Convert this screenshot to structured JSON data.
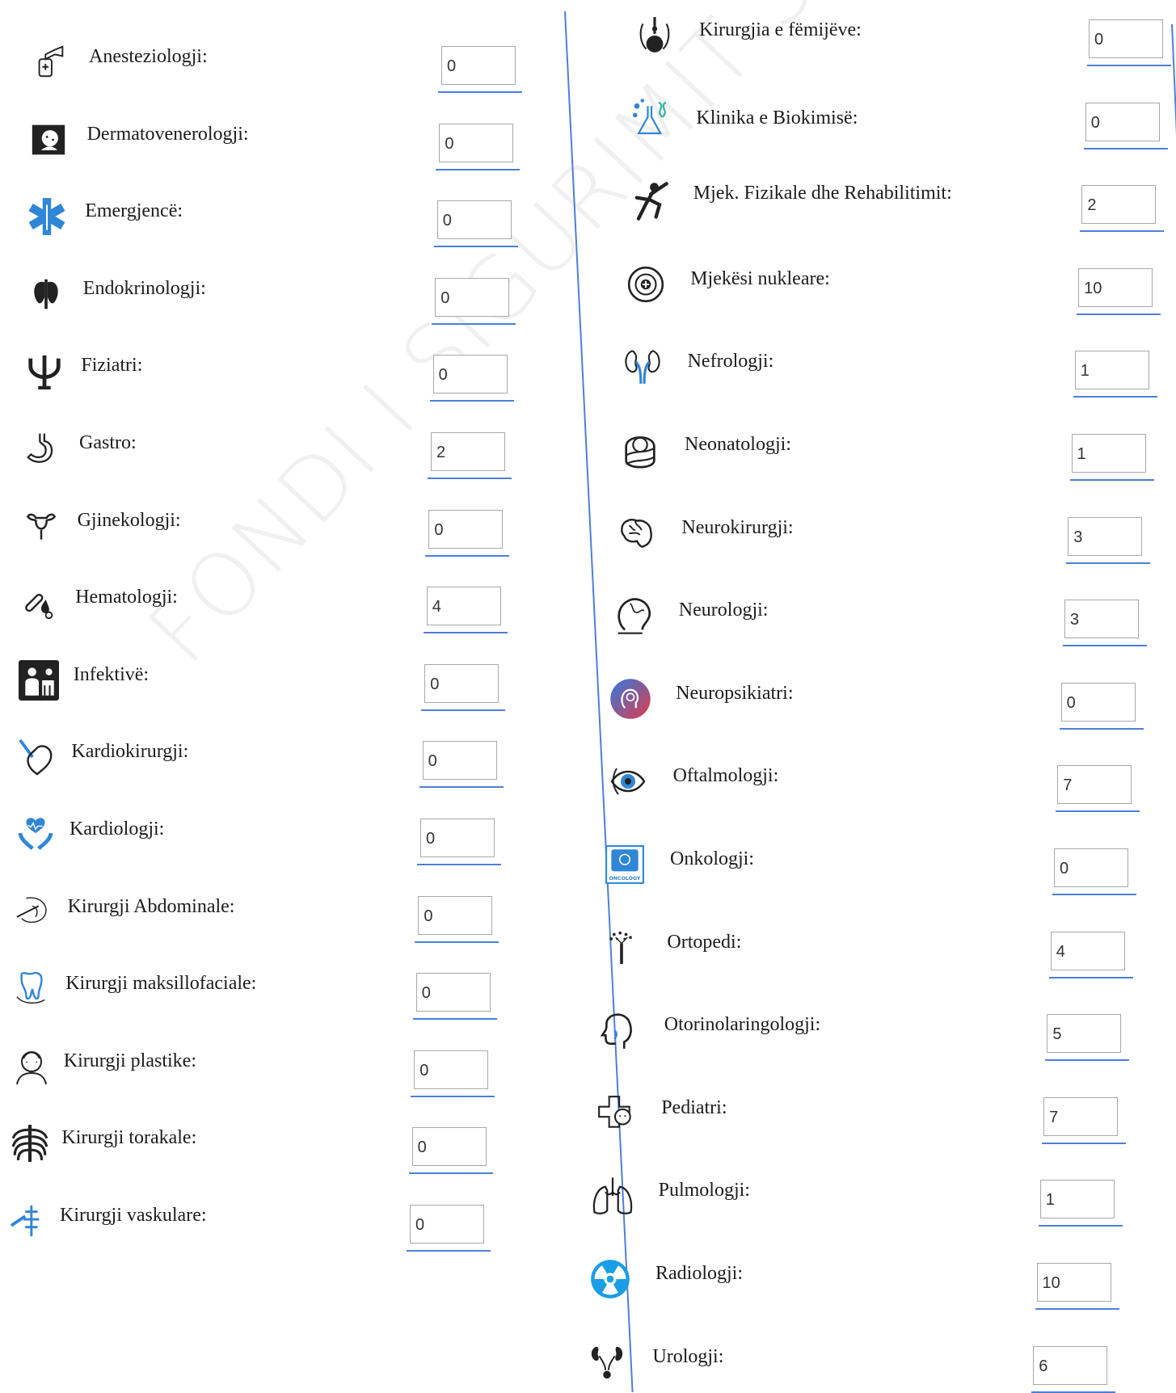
{
  "watermark": "FONDI I SIGURIMIT SHËNDETËSOR",
  "left_column": [
    {
      "label": "Anesteziologji:",
      "value": "0",
      "icon": "anesthesia-mask-icon"
    },
    {
      "label": "Dermatovenerologji:",
      "value": "0",
      "icon": "dermatology-face-icon"
    },
    {
      "label": "Emergjencë:",
      "value": "0",
      "icon": "star-of-life-icon"
    },
    {
      "label": "Endokrinologji:",
      "value": "0",
      "icon": "thyroid-gland-icon"
    },
    {
      "label": "Fiziatri:",
      "value": "0",
      "icon": "psi-symbol-icon"
    },
    {
      "label": "Gastro:",
      "value": "2",
      "icon": "stomach-icon"
    },
    {
      "label": "Gjinekologji:",
      "value": "0",
      "icon": "uterus-icon"
    },
    {
      "label": "Hematologji:",
      "value": "4",
      "icon": "blood-sample-icon"
    },
    {
      "label": "Infektivë:",
      "value": "0",
      "icon": "infectious-disease-icon"
    },
    {
      "label": "Kardiokirurgji:",
      "value": "0",
      "icon": "heart-surgery-icon"
    },
    {
      "label": "Kardiologji:",
      "value": "0",
      "icon": "heart-in-hands-icon"
    },
    {
      "label": "Kirurgji Abdominale:",
      "value": "0",
      "icon": "abdominal-surgery-icon"
    },
    {
      "label": "Kirurgji maksillofaciale:",
      "value": "0",
      "icon": "tooth-jaw-icon"
    },
    {
      "label": "Kirurgji plastike:",
      "value": "0",
      "icon": "plastic-surgery-face-icon"
    },
    {
      "label": "Kirurgji torakale:",
      "value": "0",
      "icon": "rib-cage-icon"
    },
    {
      "label": "Kirurgji vaskulare:",
      "value": "0",
      "icon": "vascular-syringe-icon"
    }
  ],
  "right_column": [
    {
      "label": "Kirurgjia e fëmijëve:",
      "value": "0",
      "icon": "child-surgery-icon"
    },
    {
      "label": "Klinika e Biokimisë:",
      "value": "0",
      "icon": "biochemistry-flask-icon"
    },
    {
      "label": "Mjek. Fizikale dhe Rehabilitimit:",
      "value": "2",
      "icon": "running-person-icon"
    },
    {
      "label": "Mjekësi nukleare:",
      "value": "10",
      "icon": "nuclear-medicine-icon"
    },
    {
      "label": "Nefrologji:",
      "value": "1",
      "icon": "kidneys-icon"
    },
    {
      "label": "Neonatologji:",
      "value": "1",
      "icon": "newborn-baby-icon"
    },
    {
      "label": "Neurokirurgji:",
      "value": "3",
      "icon": "brain-icon"
    },
    {
      "label": "Neurologji:",
      "value": "3",
      "icon": "neurology-head-icon"
    },
    {
      "label": "Neuropsikiatri:",
      "value": "0",
      "icon": "neuropsychiatry-head-icon"
    },
    {
      "label": "Oftalmologji:",
      "value": "7",
      "icon": "eye-icon"
    },
    {
      "label": "Onkologji:",
      "value": "0",
      "icon": "oncology-icon"
    },
    {
      "label": "Ortopedi:",
      "value": "4",
      "icon": "bone-icon"
    },
    {
      "label": "Otorinolaringologji:",
      "value": "5",
      "icon": "ent-head-icon"
    },
    {
      "label": "Pediatri:",
      "value": "7",
      "icon": "pediatric-cross-icon"
    },
    {
      "label": "Pulmologji:",
      "value": "1",
      "icon": "lungs-icon"
    },
    {
      "label": "Radiologji:",
      "value": "10",
      "icon": "radiation-icon"
    },
    {
      "label": "Urologji:",
      "value": "6",
      "icon": "urinary-tract-icon"
    }
  ],
  "colors": {
    "accent_line": "#4e7fd8",
    "icon_blue": "#2f86d6",
    "icon_dark": "#222222"
  }
}
